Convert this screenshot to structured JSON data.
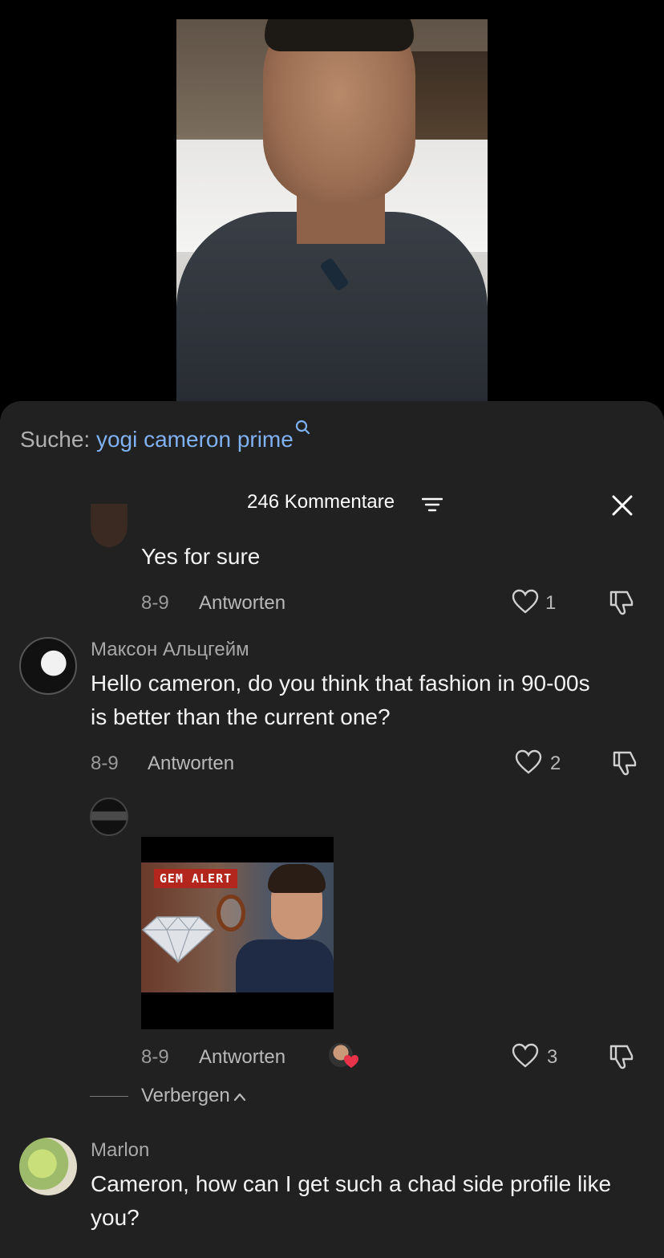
{
  "search": {
    "label": "Suche:",
    "query": "yogi cameron prime"
  },
  "header": {
    "count_label": "246 Kommentare"
  },
  "comments": [
    {
      "text": "Yes for sure",
      "date": "8-9",
      "reply_label": "Antworten",
      "likes": "1"
    },
    {
      "username": "Максон Альцгейм",
      "text": "Hello cameron, do you think that fashion in 90-00s is better than the current one?",
      "date": "8-9",
      "reply_label": "Antworten",
      "likes": "2"
    },
    {
      "gif_caption": "GEM ALERT",
      "date": "8-9",
      "reply_label": "Antworten",
      "likes": "3"
    },
    {
      "username": "Marlon",
      "text": "Cameron, how can I get such a chad side profile like you?"
    }
  ],
  "hide_label": "Verbergen",
  "colors": {
    "accent_link": "#7fb1f3",
    "sheet_bg": "#212121",
    "like_heart": "#e8334a"
  }
}
